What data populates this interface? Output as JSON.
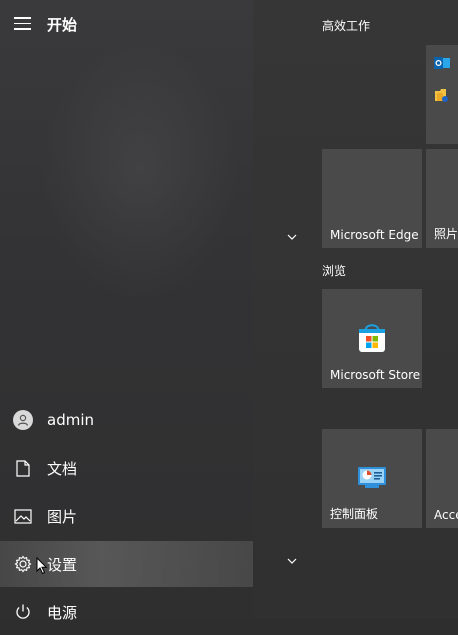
{
  "start_menu": {
    "title": "开始",
    "user": {
      "name": "admin"
    },
    "nav_items": [
      {
        "id": "documents",
        "label": "文档",
        "icon": "document-icon"
      },
      {
        "id": "pictures",
        "label": "图片",
        "icon": "picture-icon"
      },
      {
        "id": "settings",
        "label": "设置",
        "icon": "gear-icon",
        "selected": true
      },
      {
        "id": "power",
        "label": "电源",
        "icon": "power-icon"
      }
    ]
  },
  "tiles": {
    "groups": [
      {
        "name": "高效工作"
      },
      {
        "name": "浏览"
      }
    ],
    "items": [
      {
        "label": "Microsoft Edge"
      },
      {
        "label": "照片"
      },
      {
        "label": "Microsoft Store"
      },
      {
        "label": "控制面板"
      },
      {
        "label": "Accessories"
      }
    ],
    "small_tile_icons": [
      "outlook-icon",
      "file-explorer-icon"
    ]
  },
  "colors": {
    "tile_background": "#4a4a4a",
    "left_pane": "#343436",
    "right_pane": "#333333"
  }
}
